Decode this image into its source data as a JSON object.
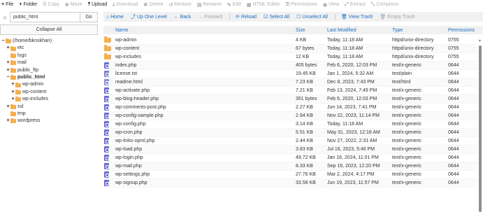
{
  "toolbar": [
    {
      "label": "File",
      "icon": "+",
      "enabled": true
    },
    {
      "label": "Folder",
      "icon": "+",
      "enabled": true
    },
    {
      "label": "Copy",
      "icon": "©",
      "enabled": false
    },
    {
      "label": "Move",
      "icon": "✥",
      "enabled": false
    },
    {
      "label": "Upload",
      "icon": "⤒",
      "enabled": true
    },
    {
      "label": "Download",
      "icon": "⤓",
      "enabled": false
    },
    {
      "label": "Delete",
      "icon": "✖",
      "enabled": false
    },
    {
      "label": "Restore",
      "icon": "↺",
      "enabled": false
    },
    {
      "label": "Rename",
      "icon": "▤",
      "enabled": false
    },
    {
      "label": "Edit",
      "icon": "✎",
      "enabled": false
    },
    {
      "label": "HTML Editor",
      "icon": "▦",
      "enabled": false
    },
    {
      "label": "Permissions",
      "icon": "⚿",
      "enabled": false
    },
    {
      "label": "View",
      "icon": "◉",
      "enabled": false
    },
    {
      "label": "Extract",
      "icon": "⤢",
      "enabled": false
    },
    {
      "label": "Compress",
      "icon": "⤡",
      "enabled": false
    }
  ],
  "path": {
    "value": "public_html",
    "go_label": "Go"
  },
  "collapse_label": "Collapse All",
  "tree": [
    {
      "label": "(/home/bknskhan)",
      "toggle": "−",
      "indent": 0,
      "bold": false
    },
    {
      "label": "etc",
      "toggle": "+",
      "indent": 1,
      "bold": false
    },
    {
      "label": "logs",
      "toggle": "",
      "indent": 1,
      "bold": false
    },
    {
      "label": "mail",
      "toggle": "+",
      "indent": 1,
      "bold": false
    },
    {
      "label": "public_ftp",
      "toggle": "+",
      "indent": 1,
      "bold": false
    },
    {
      "label": "public_html",
      "toggle": "−",
      "indent": 1,
      "bold": true
    },
    {
      "label": "wp-admin",
      "toggle": "+",
      "indent": 2,
      "bold": false
    },
    {
      "label": "wp-content",
      "toggle": "+",
      "indent": 2,
      "bold": false
    },
    {
      "label": "wp-includes",
      "toggle": "+",
      "indent": 2,
      "bold": false
    },
    {
      "label": "ssl",
      "toggle": "+",
      "indent": 1,
      "bold": false
    },
    {
      "label": "tmp",
      "toggle": "",
      "indent": 1,
      "bold": false
    },
    {
      "label": "wordpress",
      "toggle": "+",
      "indent": 1,
      "bold": false
    }
  ],
  "actions": [
    {
      "label": "Home",
      "icon": "⌂",
      "enabled": true
    },
    {
      "label": "Up One Level",
      "icon": "⤴",
      "enabled": true
    },
    {
      "label": "Back",
      "icon": "←",
      "enabled": true
    },
    {
      "label": "Forward",
      "icon": "→",
      "enabled": false
    },
    {
      "label": "Reload",
      "icon": "⟳",
      "enabled": true
    },
    {
      "label": "Select All",
      "icon": "☑",
      "enabled": true
    },
    {
      "label": "Unselect All",
      "icon": "☐",
      "enabled": true
    },
    {
      "label": "View Trash",
      "icon": "🗑",
      "enabled": true
    },
    {
      "label": "Empty Trash",
      "icon": "🗑",
      "enabled": false
    }
  ],
  "columns": {
    "name": "Name",
    "size": "Size",
    "modified": "Last Modified",
    "type": "Type",
    "perms": "Permissions"
  },
  "files": [
    {
      "kind": "folder",
      "name": "wp-admin",
      "size": "4 KB",
      "modified": "Today, 11:18 AM",
      "type": "httpd/unix-directory",
      "perms": "0755"
    },
    {
      "kind": "folder",
      "name": "wp-content",
      "size": "67 bytes",
      "modified": "Today, 11:18 AM",
      "type": "httpd/unix-directory",
      "perms": "0755"
    },
    {
      "kind": "folder",
      "name": "wp-includes",
      "size": "12 KB",
      "modified": "Today, 11:18 AM",
      "type": "httpd/unix-directory",
      "perms": "0755"
    },
    {
      "kind": "file",
      "name": "index.php",
      "size": "405 bytes",
      "modified": "Feb 6, 2020, 12:03 PM",
      "type": "text/x-generic",
      "perms": "0644"
    },
    {
      "kind": "txt",
      "name": "license.txt",
      "size": "19.45 KB",
      "modified": "Jan 1, 2024, 5:32 AM",
      "type": "text/plain",
      "perms": "0644"
    },
    {
      "kind": "html",
      "name": "readme.html",
      "size": "7.23 KB",
      "modified": "Dec 8, 2023, 7:43 PM",
      "type": "text/html",
      "perms": "0644"
    },
    {
      "kind": "file",
      "name": "wp-activate.php",
      "size": "7.21 KB",
      "modified": "Feb 13, 2024, 7:49 PM",
      "type": "text/x-generic",
      "perms": "0644"
    },
    {
      "kind": "file",
      "name": "wp-blog-header.php",
      "size": "351 bytes",
      "modified": "Feb 6, 2020, 12:03 PM",
      "type": "text/x-generic",
      "perms": "0644"
    },
    {
      "kind": "file",
      "name": "wp-comments-post.php",
      "size": "2.27 KB",
      "modified": "Jun 14, 2023, 7:41 PM",
      "type": "text/x-generic",
      "perms": "0644"
    },
    {
      "kind": "file",
      "name": "wp-config-sample.php",
      "size": "2.94 KB",
      "modified": "Nov 22, 2023, 11:14 PM",
      "type": "text/x-generic",
      "perms": "0644"
    },
    {
      "kind": "file",
      "name": "wp-config.php",
      "size": "3.14 KB",
      "modified": "Today, 11:18 AM",
      "type": "text/x-generic",
      "perms": "0644"
    },
    {
      "kind": "file",
      "name": "wp-cron.php",
      "size": "5.51 KB",
      "modified": "May 31, 2023, 12:18 AM",
      "type": "text/x-generic",
      "perms": "0644"
    },
    {
      "kind": "file",
      "name": "wp-links-opml.php",
      "size": "2.44 KB",
      "modified": "Nov 27, 2022, 2:31 AM",
      "type": "text/x-generic",
      "perms": "0644"
    },
    {
      "kind": "file",
      "name": "wp-load.php",
      "size": "3.83 KB",
      "modified": "Jul 16, 2023, 5:46 PM",
      "type": "text/x-generic",
      "perms": "0644"
    },
    {
      "kind": "file",
      "name": "wp-login.php",
      "size": "49.72 KB",
      "modified": "Jan 16, 2024, 11:01 PM",
      "type": "text/x-generic",
      "perms": "0644"
    },
    {
      "kind": "file",
      "name": "wp-mail.php",
      "size": "8.33 KB",
      "modified": "Sep 16, 2023, 12:20 PM",
      "type": "text/x-generic",
      "perms": "0644"
    },
    {
      "kind": "file",
      "name": "wp-settings.php",
      "size": "27.76 KB",
      "modified": "Mar 2, 2024, 4:17 PM",
      "type": "text/x-generic",
      "perms": "0644"
    },
    {
      "kind": "file",
      "name": "wp-signup.php",
      "size": "33.58 KB",
      "modified": "Jun 19, 2023, 11:57 PM",
      "type": "text/x-generic",
      "perms": "0644"
    }
  ]
}
